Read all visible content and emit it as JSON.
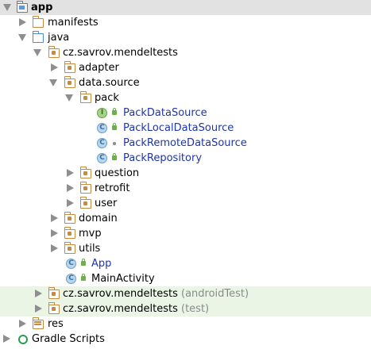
{
  "tree": {
    "app": "app",
    "manifests": "manifests",
    "java": "java",
    "pkg_main": "cz.savrov.mendeltests",
    "adapter": "adapter",
    "data_source": "data.source",
    "pack": "pack",
    "pack_data_source": "PackDataSource",
    "pack_local_data_source": "PackLocalDataSource",
    "pack_remote_data_source": "PackRemoteDataSource",
    "pack_repository": "PackRepository",
    "question": "question",
    "retrofit": "retrofit",
    "user": "user",
    "domain": "domain",
    "mvp": "mvp",
    "utils": "utils",
    "app_class": "App",
    "main_activity": "MainActivity",
    "pkg_android_test": "cz.savrov.mendeltests",
    "pkg_android_test_suffix": "(androidTest)",
    "pkg_test": "cz.savrov.mendeltests",
    "pkg_test_suffix": "(test)",
    "res": "res",
    "gradle_scripts": "Gradle Scripts"
  },
  "icon_letters": {
    "class": "C",
    "interface": "I"
  },
  "colors": {
    "selection": "#e2e2e2",
    "test_highlight": "#eaf5e6",
    "class_name": "#1f36a8",
    "folder": "#c88a3c",
    "source_folder": "#4d8ad2"
  }
}
